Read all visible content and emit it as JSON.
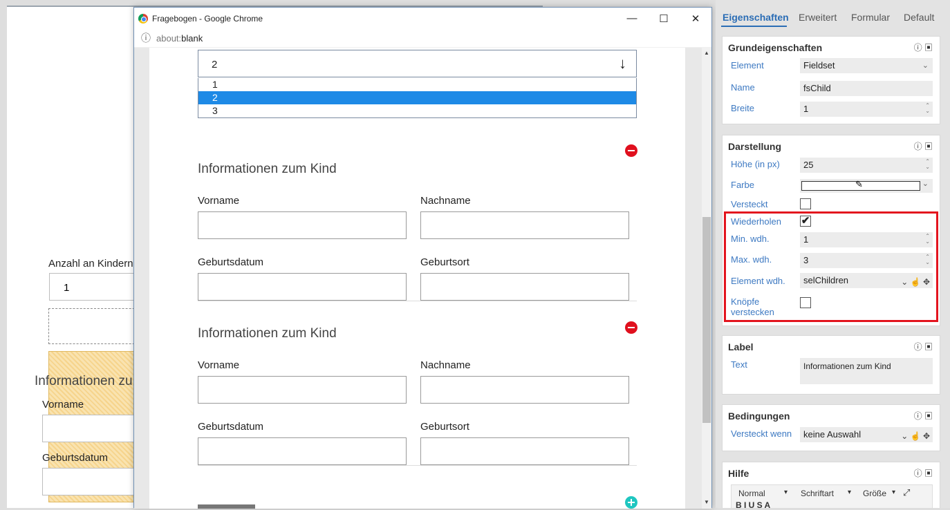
{
  "background_page": {
    "count_label": "Anzahl an Kindern",
    "count_value": "1",
    "section_title": "Informationen zu",
    "first_name": "Vorname",
    "birth_date": "Geburtsdatum"
  },
  "window": {
    "title": "Fragebogen - Google Chrome",
    "minimize": "—",
    "maximize": "☐",
    "close": "✕",
    "address_scheme": "about:",
    "address_path": "blank",
    "info_icon": "ⓘ"
  },
  "form": {
    "select_value": "2",
    "select_arrow": "↓",
    "options": [
      "1",
      "2",
      "3"
    ],
    "selected_option": "2",
    "fieldsets": [
      {
        "title": "Informationen zum Kind",
        "first_name": "Vorname",
        "last_name": "Nachname",
        "birth_date": "Geburtsdatum",
        "birth_place": "Geburtsort"
      },
      {
        "title": "Informationen zum Kind",
        "first_name": "Vorname",
        "last_name": "Nachname",
        "birth_date": "Geburtsdatum",
        "birth_place": "Geburtsort"
      }
    ]
  },
  "panel": {
    "tabs": [
      "Eigenschaften",
      "Erweitert",
      "Formular",
      "Default"
    ],
    "active_tab": "Eigenschaften",
    "grund": {
      "title": "Grundeigenschaften",
      "element_label": "Element",
      "element_value": "Fieldset",
      "name_label": "Name",
      "name_value": "fsChild",
      "breite_label": "Breite",
      "breite_value": "1"
    },
    "darstellung": {
      "title": "Darstellung",
      "hoehe_label": "Höhe (in px)",
      "hoehe_value": "25",
      "farbe_label": "Farbe",
      "versteckt_label": "Versteckt",
      "versteckt_checked": false,
      "wiederholen_label": "Wiederholen",
      "wiederholen_checked": true,
      "min_label": "Min. wdh.",
      "min_value": "1",
      "max_label": "Max. wdh.",
      "max_value": "3",
      "element_wdh_label": "Element wdh.",
      "element_wdh_value": "selChildren",
      "knoepfe_label_1": "Knöpfe",
      "knoepfe_label_2": "verstecken",
      "knoepfe_checked": false,
      "highlight_color": "#e3141e"
    },
    "label": {
      "title": "Label",
      "text_label": "Text",
      "text_value": "Informationen zum Kind"
    },
    "bedingungen": {
      "title": "Bedingungen",
      "versteckt_wenn_label": "Versteckt wenn",
      "versteckt_wenn_value": "keine Auswahl"
    },
    "hilfe": {
      "title": "Hilfe",
      "format": "Normal",
      "font": "Schriftart",
      "size": "Größe",
      "toolbar_row2": "B I U S A"
    }
  },
  "colors": {
    "accent": "#2b6db5",
    "selection": "#1e8ae6",
    "remove": "#e0101e",
    "add": "#1fc6c0"
  }
}
